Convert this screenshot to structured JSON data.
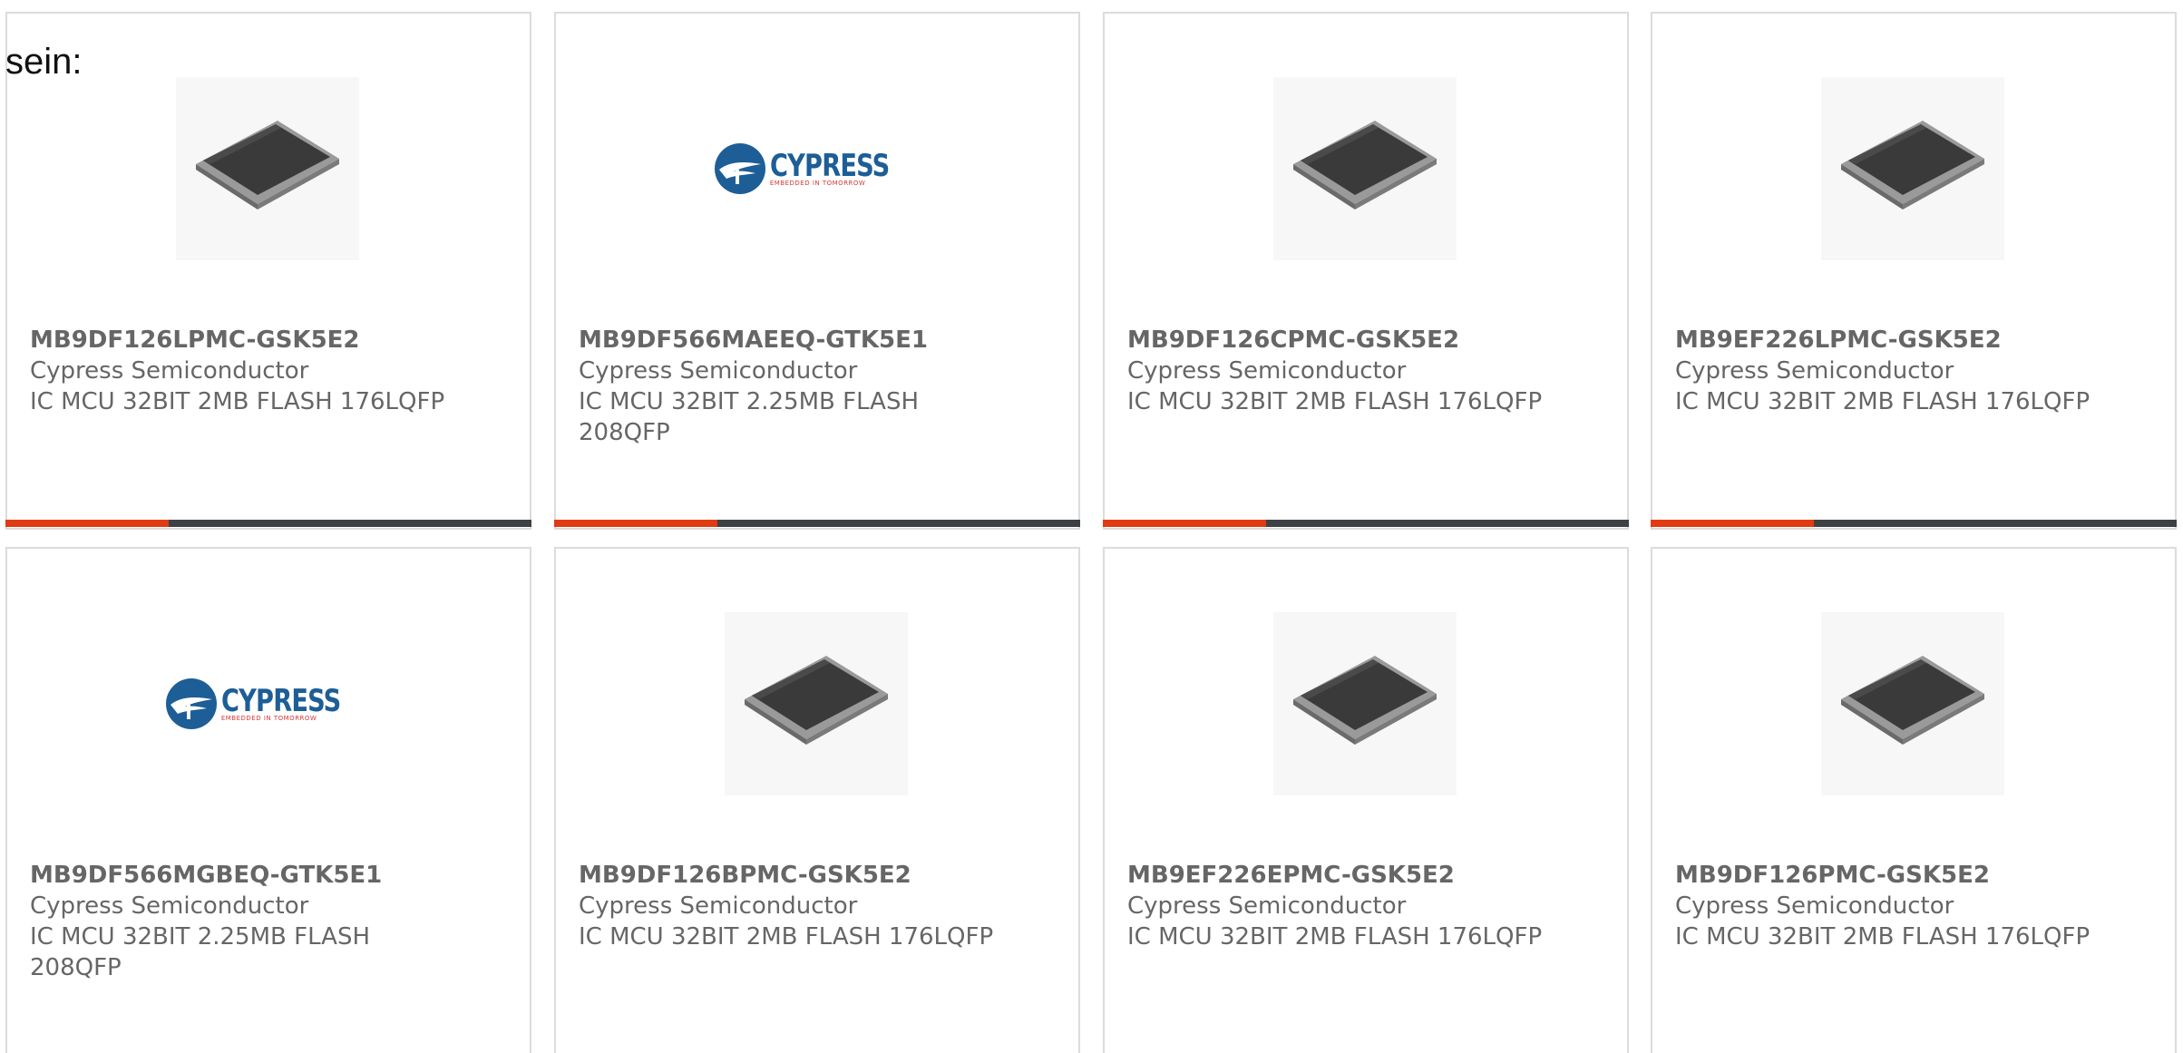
{
  "intro": {
    "text": "sein:"
  },
  "products": [
    {
      "part_number": "MB9DF126LPMC-GSK5E2",
      "manufacturer": "Cypress Semiconductor",
      "description": "IC MCU 32BIT 2MB FLASH 176LQFP",
      "image": "chip-icon",
      "progress": 0.31
    },
    {
      "part_number": "MB9DF566MAEEQ-GTK5E1",
      "manufacturer": "Cypress Semiconductor",
      "description": "IC MCU 32BIT 2.25MB FLASH 208QFP",
      "image": "cypress-logo",
      "progress": 0.31
    },
    {
      "part_number": "MB9DF126CPMC-GSK5E2",
      "manufacturer": "Cypress Semiconductor",
      "description": "IC MCU 32BIT 2MB FLASH 176LQFP",
      "image": "chip-icon",
      "progress": 0.31
    },
    {
      "part_number": "MB9EF226LPMC-GSK5E2",
      "manufacturer": "Cypress Semiconductor",
      "description": "IC MCU 32BIT 2MB FLASH 176LQFP",
      "image": "chip-icon",
      "progress": 0.31
    },
    {
      "part_number": "MB9DF566MGBEQ-GTK5E1",
      "manufacturer": "Cypress Semiconductor",
      "description": "IC MCU 32BIT 2.25MB FLASH 208QFP",
      "image": "cypress-logo"
    },
    {
      "part_number": "MB9DF126BPMC-GSK5E2",
      "manufacturer": "Cypress Semiconductor",
      "description": "IC MCU 32BIT 2MB FLASH 176LQFP",
      "image": "chip-icon"
    },
    {
      "part_number": "MB9EF226EPMC-GSK5E2",
      "manufacturer": "Cypress Semiconductor",
      "description": "IC MCU 32BIT 2MB FLASH 176LQFP",
      "image": "chip-icon"
    },
    {
      "part_number": "MB9DF126PMC-GSK5E2",
      "manufacturer": "Cypress Semiconductor",
      "description": "IC MCU 32BIT 2MB FLASH 176LQFP",
      "image": "chip-icon"
    }
  ],
  "logo": {
    "name": "CYPRESS",
    "tagline": "EMBEDDED IN TOMORROW"
  },
  "colors": {
    "accent": "#e13b12",
    "bar_track": "#3e4144",
    "text": "#666666",
    "border": "#dcdcdc",
    "logo_blue": "#1d5e97",
    "logo_red": "#d8363a"
  }
}
